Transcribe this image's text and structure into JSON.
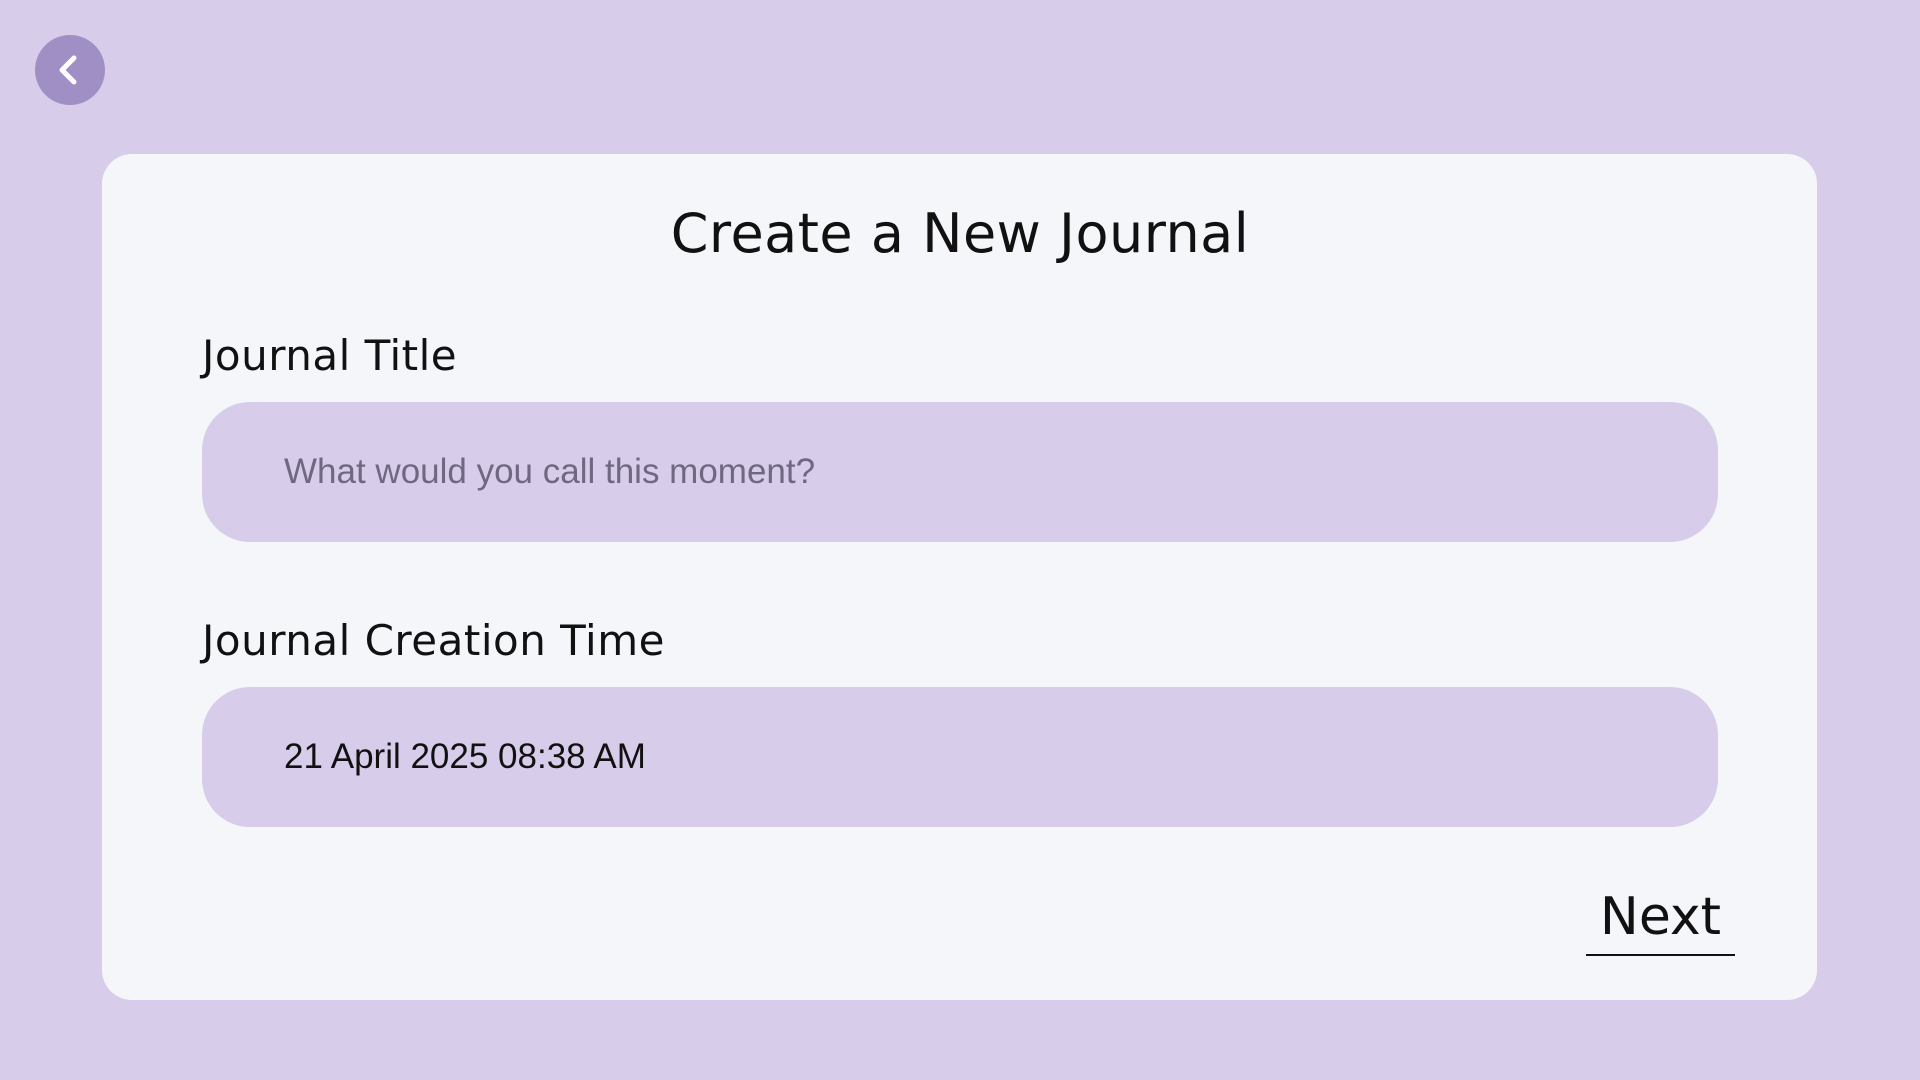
{
  "nav": {
    "back_icon": "chevron-left-icon"
  },
  "form": {
    "title": "Create a New Journal",
    "journal_title": {
      "label": "Journal Title",
      "value": "",
      "placeholder": "What would you call this moment?"
    },
    "creation_time": {
      "label": "Journal Creation Time",
      "value": "21 April 2025 08:38 AM"
    },
    "next_label": "Next"
  },
  "colors": {
    "background": "#d7cdeb",
    "card": "#f5f6fa",
    "accent": "#a08fc4",
    "input_fill": "#d7cdeb",
    "text": "#111111",
    "placeholder": "#6f6880"
  }
}
